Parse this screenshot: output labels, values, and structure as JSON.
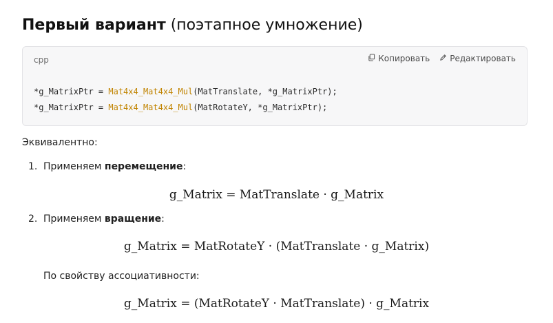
{
  "heading": {
    "bold": "Первый вариант",
    "normal": "(поэтапное умножение)"
  },
  "code": {
    "language": "cpp",
    "copy_label": "Копировать",
    "edit_label": "Редактировать",
    "line1_a": "*g_MatrixPtr = ",
    "line1_fn": "Mat4x4_Mat4x4_Mul",
    "line1_b": "(MatTranslate, *g_MatrixPtr);",
    "line2_a": "*g_MatrixPtr = ",
    "line2_fn": "Mat4x4_Mat4x4_Mul",
    "line2_b": "(MatRotateY, *g_MatrixPtr);"
  },
  "text": {
    "equivalent": "Эквивалентно:",
    "step1_num": "1.",
    "step1_pre": "Применяем ",
    "step1_bold": "перемещение",
    "step1_post": ":",
    "formula1": "g_Matrix = MatTranslate · g_Matrix",
    "step2_num": "2.",
    "step2_pre": "Применяем ",
    "step2_bold": "вращение",
    "step2_post": ":",
    "formula2": "g_Matrix = MatRotateY · (MatTranslate · g_Matrix)",
    "assoc": "По свойству ассоциативности:",
    "formula3": "g_Matrix = (MatRotateY · MatTranslate) · g_Matrix"
  },
  "colors": {
    "function_highlight": "#c18401",
    "code_background": "#f7f7f8"
  },
  "icons": {
    "copy": "copy-icon",
    "edit": "pencil-icon"
  }
}
